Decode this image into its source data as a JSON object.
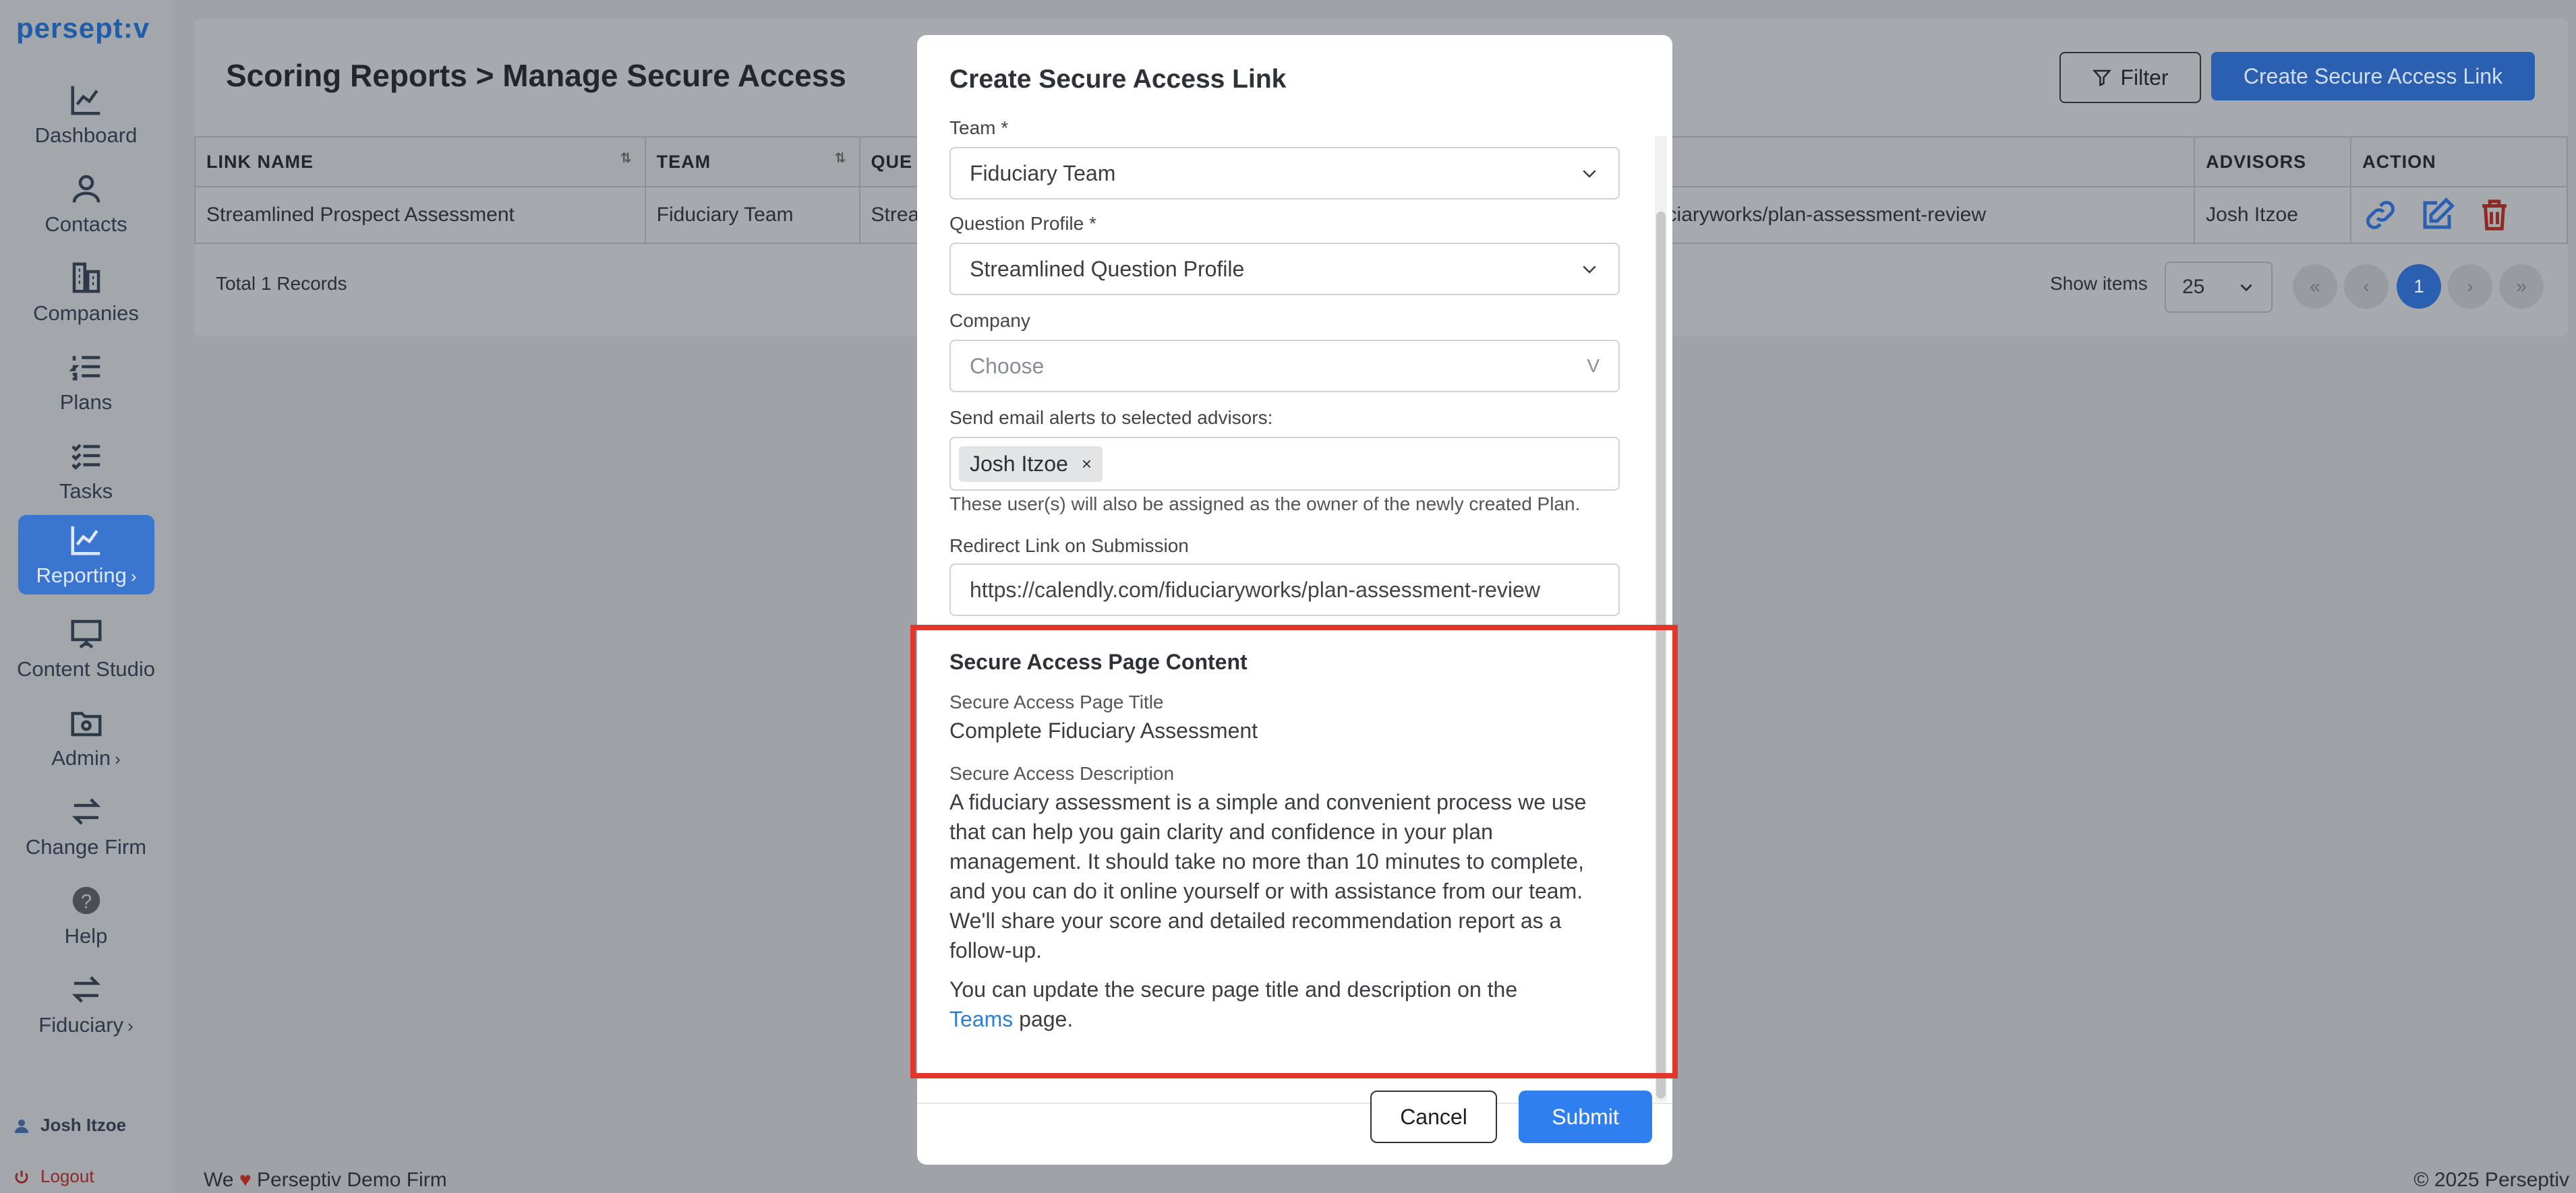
{
  "app": {
    "logo": "persept:v"
  },
  "sidebar": {
    "items": [
      {
        "label": "Dashboard",
        "icon": "chart-line-icon"
      },
      {
        "label": "Contacts",
        "icon": "user-icon"
      },
      {
        "label": "Companies",
        "icon": "building-icon"
      },
      {
        "label": "Plans",
        "icon": "list-numbered-icon"
      },
      {
        "label": "Tasks",
        "icon": "checklist-icon"
      },
      {
        "label": "Reporting",
        "icon": "chart-icon",
        "active": true,
        "has_submenu": true
      },
      {
        "label": "Content Studio",
        "icon": "presentation-icon"
      },
      {
        "label": "Admin",
        "icon": "folder-gear-icon",
        "has_submenu": true
      },
      {
        "label": "Change Firm",
        "icon": "swap-icon"
      },
      {
        "label": "Help",
        "icon": "help-icon"
      },
      {
        "label": "Fiduciary",
        "icon": "swap-icon",
        "has_submenu": true
      }
    ],
    "user": "Josh Itzoe",
    "logout": "Logout"
  },
  "header": {
    "breadcrumb": "Scoring Reports > Manage Secure Access",
    "filter_label": "Filter",
    "create_label": "Create Secure Access Link"
  },
  "table": {
    "columns": [
      "LINK NAME",
      "TEAM",
      "QUE",
      "ADVISORS",
      "ACTION"
    ],
    "rows": [
      {
        "link_name": "Streamlined Prospect Assessment",
        "team": "Fiduciary Team",
        "question": "Strea",
        "redirect": "iduciaryworks/plan-assessment-review",
        "advisors": "Josh Itzoe"
      }
    ],
    "total": "Total 1 Records",
    "show_items_label": "Show items",
    "page_size": "25",
    "current_page": "1",
    "pager": {
      "first": "«",
      "prev": "‹",
      "next": "›",
      "last": "»"
    }
  },
  "modal": {
    "title": "Create Secure Access Link",
    "team_label": "Team *",
    "team_value": "Fiduciary Team",
    "profile_label": "Question Profile *",
    "profile_value": "Streamlined Question Profile",
    "company_label": "Company",
    "company_placeholder": "Choose",
    "company_chevron": "V",
    "advisors_label": "Send email alerts to selected advisors:",
    "advisor_tag": "Josh Itzoe",
    "tag_remove": "×",
    "advisors_helper": "These user(s) will also be assigned as the owner of the newly created Plan.",
    "redirect_label": "Redirect Link on Submission",
    "redirect_value": "https://calendly.com/fiduciaryworks/plan-assessment-review",
    "content_heading": "Secure Access Page Content",
    "page_title_label": "Secure Access Page Title",
    "page_title_value": "Complete Fiduciary Assessment",
    "description_label": "Secure Access Description",
    "description_value": "A fiduciary assessment is a simple and convenient process we use that can help you gain clarity and confidence in your plan management. It should take no more than 10 minutes to complete, and you can do it online yourself or with assistance from our team. We'll share your score and detailed recommendation report as a follow-up.",
    "update_note_prefix": "You can update the secure page title and description on the",
    "update_note_link": "Teams",
    "update_note_suffix": "page.",
    "cancel_label": "Cancel",
    "submit_label": "Submit"
  },
  "footer": {
    "left_prefix": "We",
    "left_suffix": "Perseptiv Demo Firm",
    "right": "© 2025 Perseptiv"
  },
  "colors": {
    "accent": "#2f7ff0",
    "highlight": "#e2362a",
    "delete": "#c0392b"
  }
}
